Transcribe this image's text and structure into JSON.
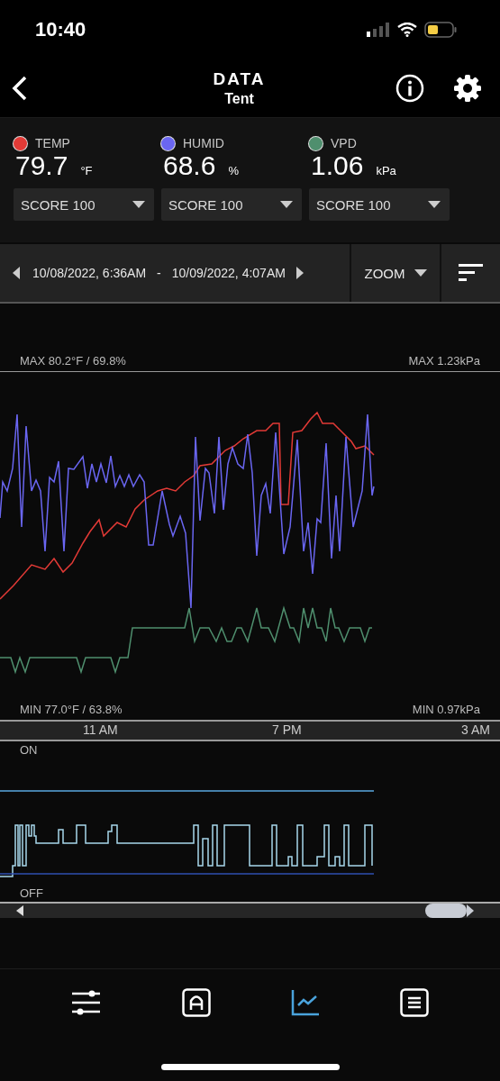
{
  "status_bar": {
    "time": "10:40"
  },
  "header": {
    "title": "DATA",
    "subtitle": "Tent"
  },
  "sensors": [
    {
      "name": "TEMP",
      "color": "#e23a36",
      "value": "79.7",
      "unit": "°F",
      "score": "SCORE 100"
    },
    {
      "name": "HUMID",
      "color": "#6a66f2",
      "value": "68.6",
      "unit": "%",
      "score": "SCORE 100"
    },
    {
      "name": "VPD",
      "color": "#4f8f6e",
      "value": "1.06",
      "unit": "kPa",
      "score": "SCORE 100"
    }
  ],
  "date_range": {
    "start": "10/08/2022, 6:36AM",
    "separator": "-",
    "end": "10/09/2022, 4:07AM",
    "zoom": "ZOOM"
  },
  "chart": {
    "max_left": "MAX 80.2°F / 69.8%",
    "max_right": "MAX 1.23kPa",
    "min_left": "MIN 77.0°F / 63.8%",
    "min_right": "MIN 0.97kPa",
    "x_labels": [
      "11 AM",
      "7 PM",
      "3 AM"
    ]
  },
  "power_chart": {
    "on_label": "ON",
    "off_label": "OFF"
  },
  "nav_tabs": [
    {
      "kind": "sliders",
      "selected": false
    },
    {
      "kind": "auto",
      "selected": false
    },
    {
      "kind": "chart",
      "selected": true
    },
    {
      "kind": "list",
      "selected": false
    }
  ]
}
